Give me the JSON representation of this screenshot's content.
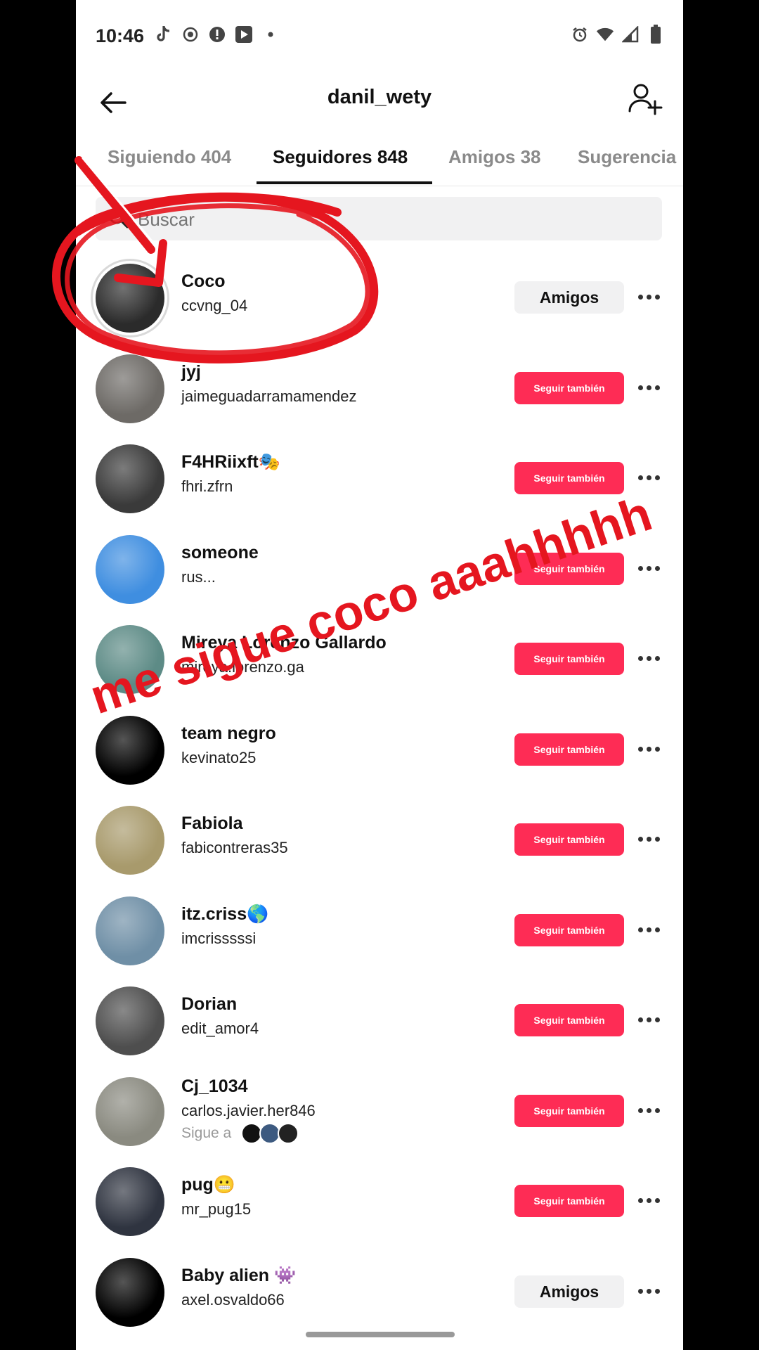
{
  "status_bar": {
    "time": "10:46",
    "left_icons": [
      "tiktok-icon",
      "location-icon",
      "alert-icon",
      "media-icon",
      "dot-icon"
    ],
    "right_icons": [
      "alarm-icon",
      "wifi-icon",
      "signal-icon",
      "battery-icon"
    ]
  },
  "header": {
    "title": "danil_wety",
    "back_icon": "arrow-left-icon",
    "add_icon": "add-user-icon"
  },
  "tabs": [
    {
      "label": "Siguiendo 404",
      "active": false
    },
    {
      "label": "Seguidores 848",
      "active": true
    },
    {
      "label": "Amigos 38",
      "active": false
    },
    {
      "label": "Sugerencia",
      "active": false
    }
  ],
  "search": {
    "placeholder": "Buscar"
  },
  "buttons": {
    "follow_back": "Seguir también",
    "friends": "Amigos"
  },
  "followers": [
    {
      "name": "Coco",
      "handle": "ccvng_04",
      "button": "Amigos",
      "avatar_color": "#2b2b2b"
    },
    {
      "name": "jyj",
      "handle": "jaimeguadarramamendez",
      "button": "Seguir también",
      "avatar_color": "#6d6a66"
    },
    {
      "name": "F4HRiixft🎭",
      "handle": "fhri.zfrn",
      "button": "Seguir también",
      "avatar_color": "#3a3a3a"
    },
    {
      "name": "someone",
      "handle": "rus...",
      "button": "Seguir también",
      "avatar_color": "#3f8ee0"
    },
    {
      "name": "Mireya Lorenzo Gallardo",
      "handle": "mireya.lorenzo.ga",
      "button": "Seguir también",
      "avatar_color": "#5d8b86"
    },
    {
      "name": "team negro",
      "handle": "kevinato25",
      "button": "Seguir también",
      "avatar_color": "#000000"
    },
    {
      "name": "Fabiola",
      "handle": "fabicontreras35",
      "button": "Seguir también",
      "avatar_color": "#a89a6c"
    },
    {
      "name": "itz.criss🌎",
      "handle": "imcrisssssi",
      "button": "Seguir también",
      "avatar_color": "#6f8fa6"
    },
    {
      "name": "Dorian",
      "handle": "edit_amor4",
      "button": "Seguir también",
      "avatar_color": "#4e4e4e"
    },
    {
      "name": "Cj_1034",
      "handle": "carlos.javier.her846",
      "sub": "Sigue a",
      "button": "Seguir también",
      "avatar_color": "#8a8a80"
    },
    {
      "name": "pug😬",
      "handle": "mr_pug15",
      "button": "Seguir también",
      "avatar_color": "#2f3440"
    },
    {
      "name": "Baby alien 👾",
      "handle": "axel.osvaldo66",
      "button": "Amigos",
      "avatar_color": "#000000"
    }
  ],
  "annotation": {
    "text": "me sigue coco aaahhhhh",
    "color": "#e5161f"
  },
  "colors": {
    "accent": "#fe2c55",
    "secondary_button": "#f1f1f2"
  }
}
